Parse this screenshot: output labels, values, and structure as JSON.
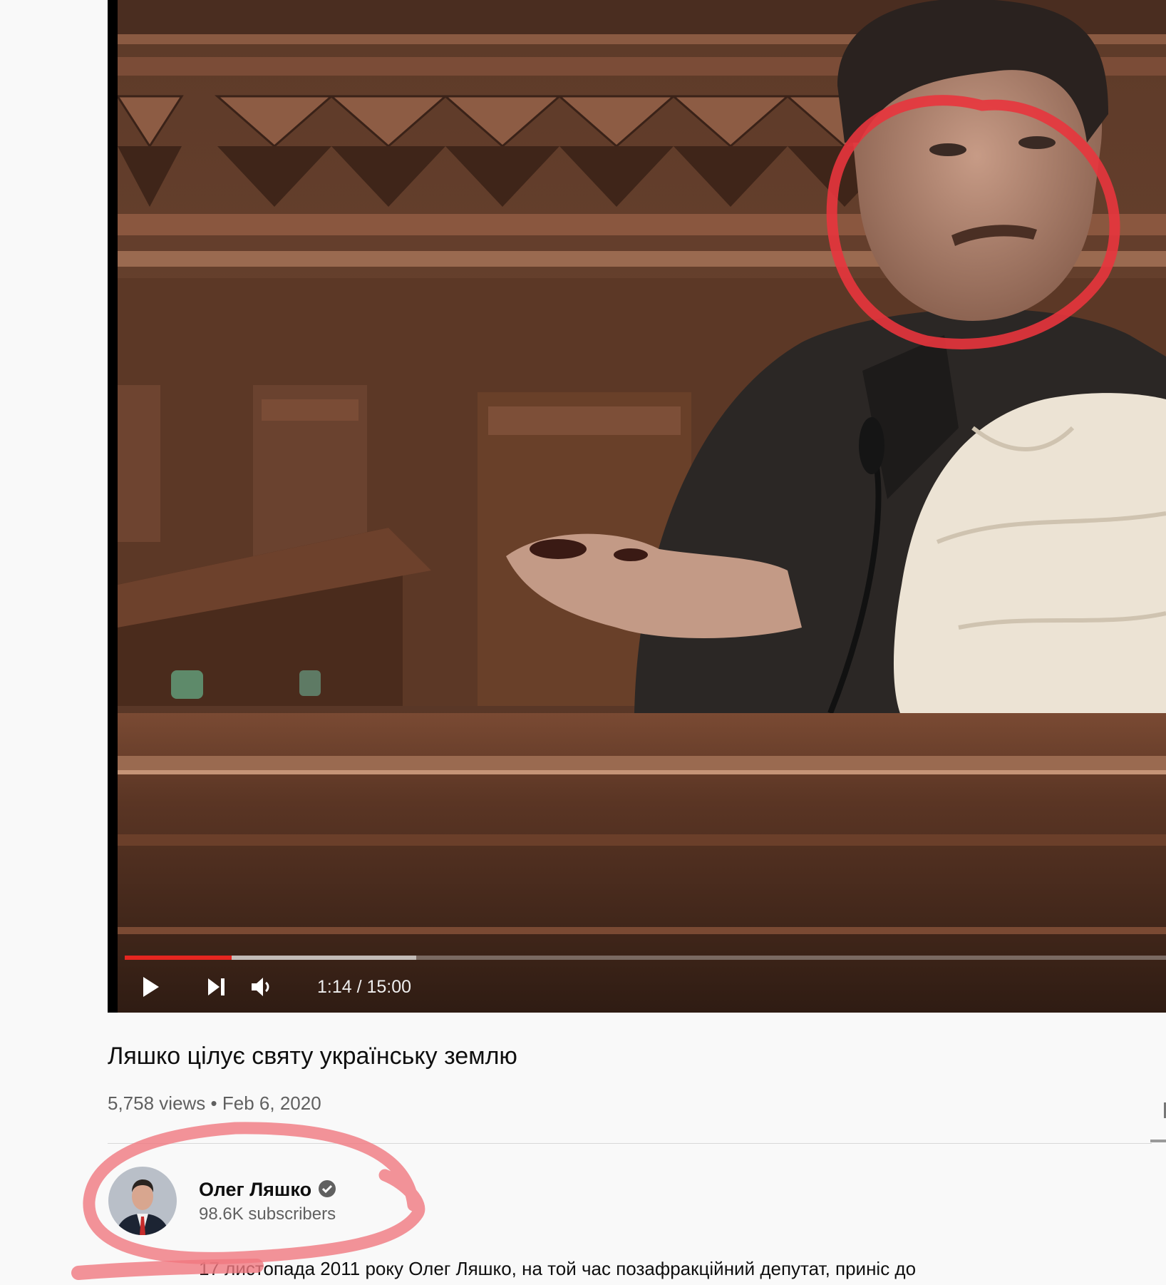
{
  "player": {
    "time_display": "1:14 / 15:00",
    "played_fraction": 0.103,
    "buffered_fraction": 0.28,
    "progress_color": "#e52620"
  },
  "video": {
    "title": "Ляшко цілує святу українську землю",
    "views": "5,758 views",
    "separator": "•",
    "date": "Feb 6, 2020"
  },
  "channel": {
    "name": "Олег Ляшко",
    "subscribers": "98.6K subscribers",
    "verified_icon": "check-circle-icon"
  },
  "description": {
    "first_line": "17 листопада 2011 року Олег Ляшко, на той час позафракційний депутат, приніс до"
  },
  "annotations": {
    "circle_color": "#e8353d",
    "underline_color": "#f0787f"
  }
}
